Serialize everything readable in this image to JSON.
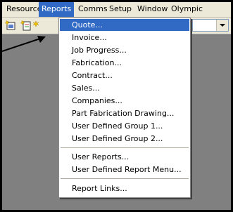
{
  "menubar": {
    "items": [
      "Resource",
      "Reports",
      "Comms",
      "Setup",
      "Window",
      "Olympic"
    ]
  },
  "toolbar": {
    "buttons": [
      "new-item-icon",
      "new-document-icon",
      "new-star-icon"
    ],
    "combo_value": ""
  },
  "reports_menu": {
    "items": [
      "Quote...",
      "Invoice...",
      "Job Progress...",
      "Fabrication...",
      "Contract...",
      "Sales...",
      "Companies...",
      "Part Fabrication Drawing...",
      "User Defined Group 1...",
      "User Defined Group 2...",
      "User Reports...",
      "User Defined Report Menu...",
      "Report Links..."
    ],
    "highlighted_index": 0
  },
  "colors": {
    "highlight": "#316ac5",
    "menubar_bg": "#ece9d8",
    "workspace_bg": "#808080"
  }
}
